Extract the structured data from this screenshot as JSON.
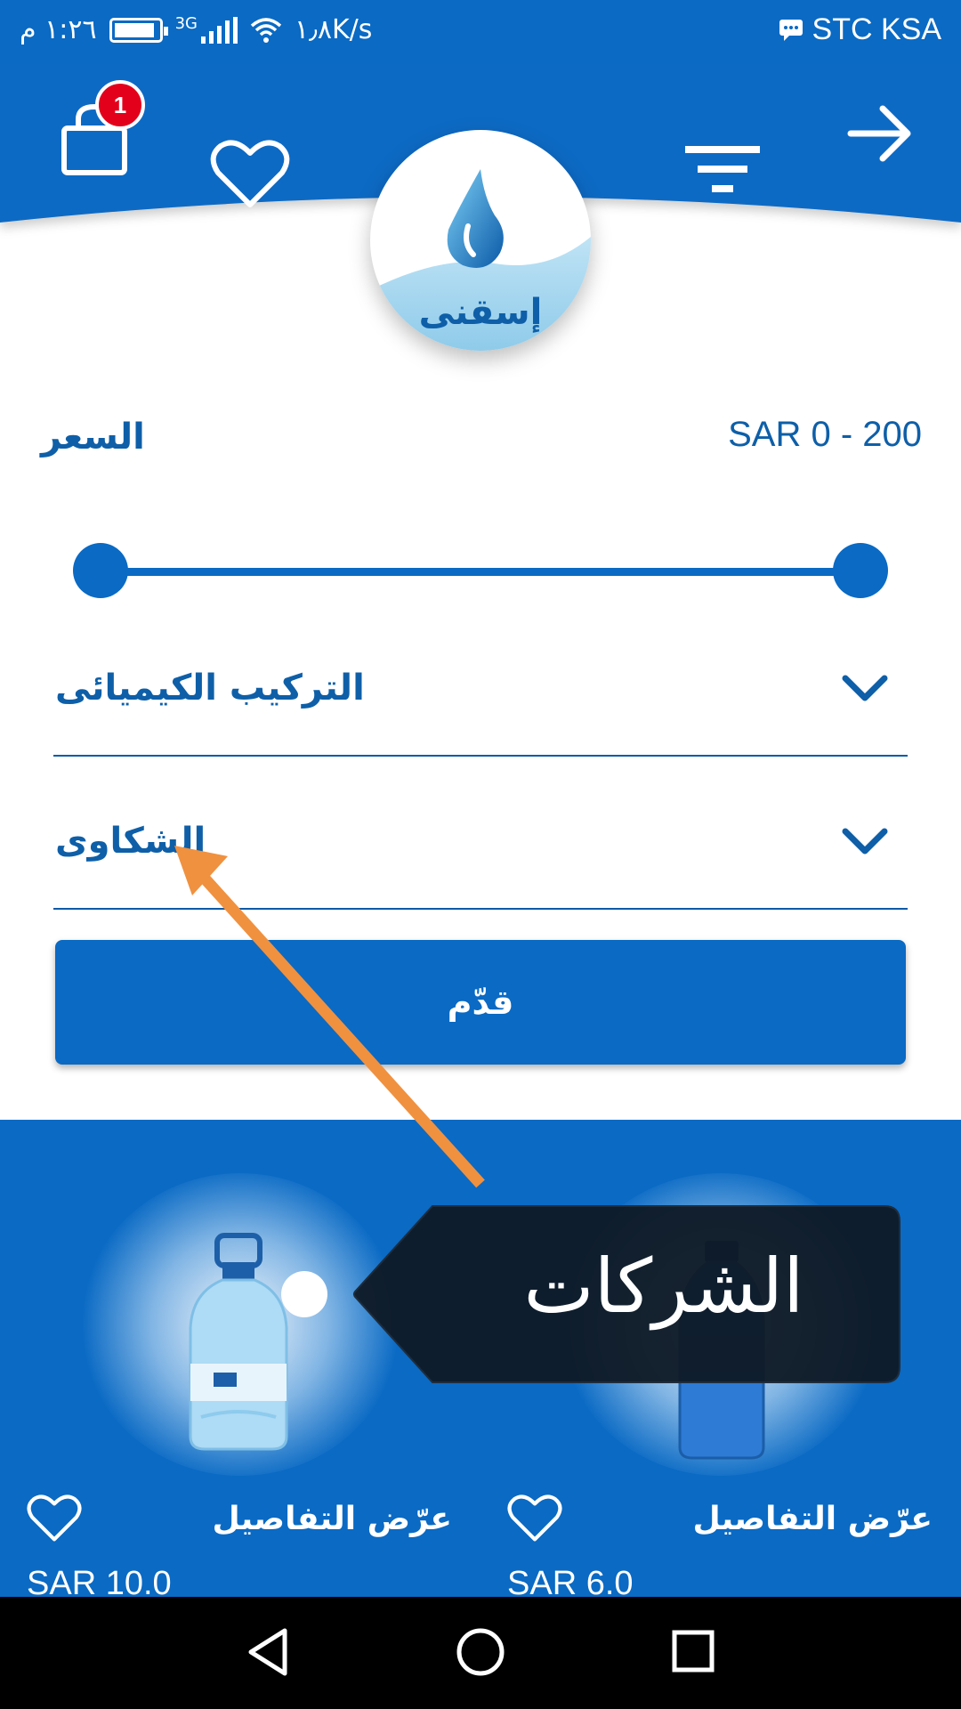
{
  "status_bar": {
    "time": "١:٢٦ م",
    "network_type": "3G",
    "speed": "١٫٨K/s",
    "carrier": "STC KSA"
  },
  "header": {
    "cart_badge": "1",
    "icons": [
      "cart-icon",
      "heart-icon",
      "filter-icon",
      "arrow-right-icon"
    ],
    "logo_text": "إسقنى"
  },
  "filters": {
    "price_label": "السعر",
    "price_range": "SAR 0 - 200",
    "slider_min_fraction": 0,
    "slider_max_fraction": 1,
    "chemical_label": "التركيب الكيميائى",
    "complaints_label": "الشكاوى",
    "submit_label": "قدّم"
  },
  "tooltip": {
    "text": "الشركات"
  },
  "products": [
    {
      "details_label": "عرّض التفاصيل",
      "price": "SAR 10.0"
    },
    {
      "details_label": "عرّض التفاصيل",
      "price": "SAR 6.0"
    }
  ],
  "colors": {
    "primary": "#0a6ac4",
    "text_blue": "#0e5fa8",
    "badge_red": "#e3001b",
    "tooltip_bg": "#0f1a26",
    "annotation_arrow": "#f0913f"
  }
}
